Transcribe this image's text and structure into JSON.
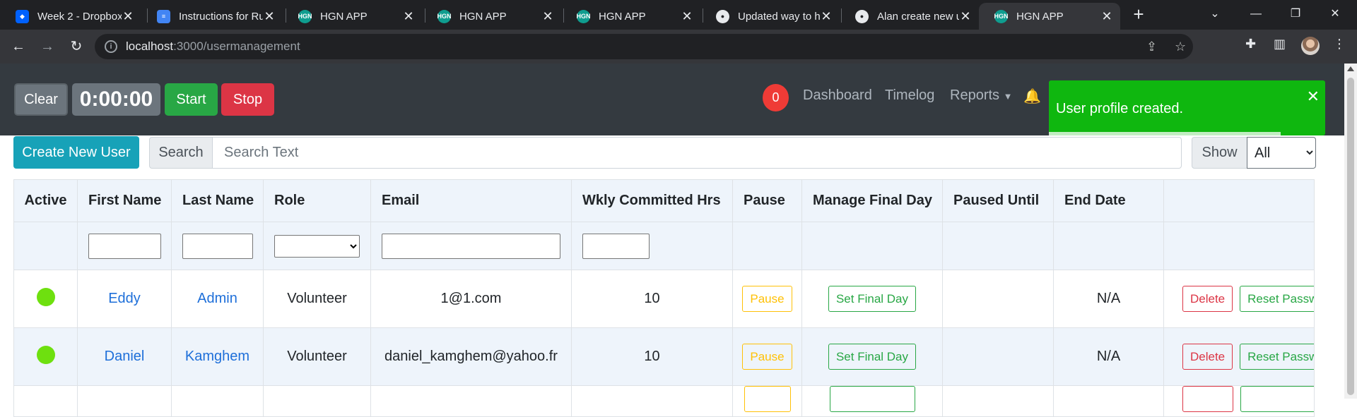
{
  "browser": {
    "tabs": [
      {
        "title": "Week 2 - Dropbox",
        "icon": "dropbox-icon"
      },
      {
        "title": "Instructions for Ru",
        "icon": "google-docs-icon"
      },
      {
        "title": "HGN APP",
        "icon": "hgn-icon"
      },
      {
        "title": "HGN APP",
        "icon": "hgn-icon"
      },
      {
        "title": "HGN APP",
        "icon": "hgn-icon"
      },
      {
        "title": "Updated way to h",
        "icon": "github-icon"
      },
      {
        "title": "Alan create new u",
        "icon": "github-icon"
      },
      {
        "title": "HGN APP",
        "icon": "hgn-icon"
      }
    ],
    "url_host": "localhost",
    "url_path": ":3000/usermanagement"
  },
  "header": {
    "clear_label": "Clear",
    "timer": "0:00:00",
    "start_label": "Start",
    "stop_label": "Stop",
    "badge_count": "0",
    "nav": {
      "dashboard": "Dashboard",
      "timelog": "Timelog",
      "reports": "Reports"
    }
  },
  "toast": {
    "message": "User profile created.",
    "progress": 0.84
  },
  "controls": {
    "create_label": "Create New User",
    "search_label": "Search",
    "search_placeholder": "Search Text",
    "show_label": "Show",
    "show_value": "All"
  },
  "table": {
    "headers": [
      "Active",
      "First Name",
      "Last Name",
      "Role",
      "Email",
      "Wkly Committed Hrs",
      "Pause",
      "Manage Final Day",
      "Paused Until",
      "End Date",
      ""
    ],
    "rows": [
      {
        "first": "Eddy",
        "last": "Admin",
        "role": "Volunteer",
        "email": "1@1.com",
        "hrs": "10",
        "pause": "Pause",
        "final": "Set Final Day",
        "paused_until": "",
        "end": "N/A",
        "delete": "Delete",
        "reset": "Reset Password"
      },
      {
        "first": "Daniel",
        "last": "Kamghem",
        "role": "Volunteer",
        "email": "daniel_kamghem@yahoo.fr",
        "hrs": "10",
        "pause": "Pause",
        "final": "Set Final Day",
        "paused_until": "",
        "end": "N/A",
        "delete": "Delete",
        "reset": "Reset Password"
      }
    ]
  },
  "colors": {
    "toast": "#0fb70f",
    "header": "#343a40",
    "active_dot": "#6ee00f"
  }
}
